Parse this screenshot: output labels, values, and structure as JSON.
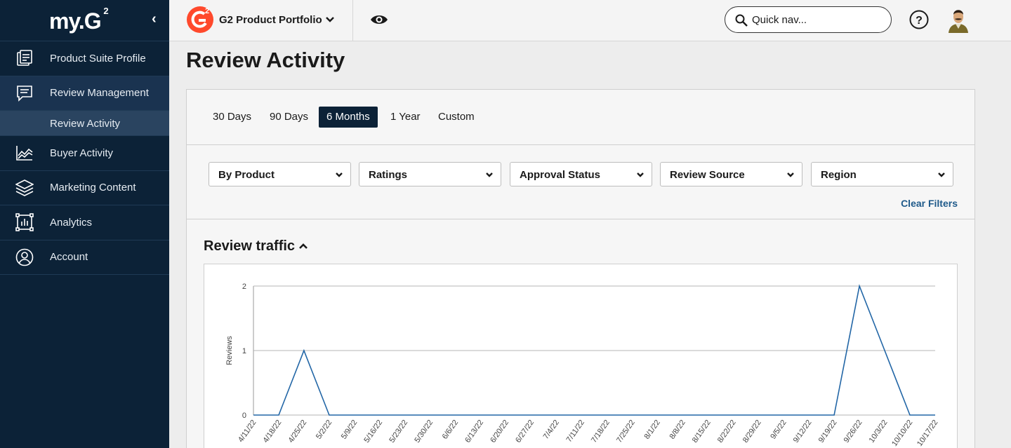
{
  "sidebar": {
    "logo_text": "my.G",
    "logo_sup": "2",
    "collapse_icon": "chevron-left-icon",
    "items": [
      {
        "label": "Product Suite Profile",
        "icon": "profile-icon"
      },
      {
        "label": "Review Management",
        "icon": "chat-icon",
        "active": true
      },
      {
        "label": "Buyer Activity",
        "icon": "trend-icon"
      },
      {
        "label": "Marketing Content",
        "icon": "layers-icon"
      },
      {
        "label": "Analytics",
        "icon": "analytics-icon"
      },
      {
        "label": "Account",
        "icon": "user-circle-icon"
      }
    ],
    "sub_item": {
      "label": "Review Activity"
    }
  },
  "topbar": {
    "badge": "G2",
    "portfolio": "G2 Product Portfolio",
    "search_placeholder": "Quick nav...",
    "help": "?"
  },
  "page": {
    "title": "Review Activity"
  },
  "ranges": [
    {
      "label": "30 Days"
    },
    {
      "label": "90 Days"
    },
    {
      "label": "6 Months",
      "active": true
    },
    {
      "label": "1 Year"
    },
    {
      "label": "Custom"
    }
  ],
  "filters": [
    {
      "label": "By Product"
    },
    {
      "label": "Ratings"
    },
    {
      "label": "Approval Status"
    },
    {
      "label": "Review Source"
    },
    {
      "label": "Region"
    }
  ],
  "clear_filters": "Clear Filters",
  "chart_section": {
    "title": "Review traffic"
  },
  "colors": {
    "sidebar_bg": "#0c2237",
    "accent": "#1f5a8a",
    "line": "#2266a6",
    "brand_red": "#ff492c"
  },
  "chart_data": {
    "type": "line",
    "title": "",
    "xlabel": "",
    "ylabel": "Reviews",
    "ylim": [
      0,
      2
    ],
    "yticks": [
      0,
      1,
      2
    ],
    "grid": true,
    "categories": [
      "4/11/22",
      "4/18/22",
      "4/25/22",
      "5/2/22",
      "5/9/22",
      "5/16/22",
      "5/23/22",
      "5/30/22",
      "6/6/22",
      "6/13/22",
      "6/20/22",
      "6/27/22",
      "7/4/22",
      "7/11/22",
      "7/18/22",
      "7/25/22",
      "8/1/22",
      "8/8/22",
      "8/15/22",
      "8/22/22",
      "8/29/22",
      "9/5/22",
      "9/12/22",
      "9/19/22",
      "9/26/22",
      "10/3/22",
      "10/10/22",
      "10/17/22"
    ],
    "values": [
      0,
      0,
      1,
      0,
      0,
      0,
      0,
      0,
      0,
      0,
      0,
      0,
      0,
      0,
      0,
      0,
      0,
      0,
      0,
      0,
      0,
      0,
      0,
      0,
      2,
      1,
      0,
      0
    ]
  }
}
